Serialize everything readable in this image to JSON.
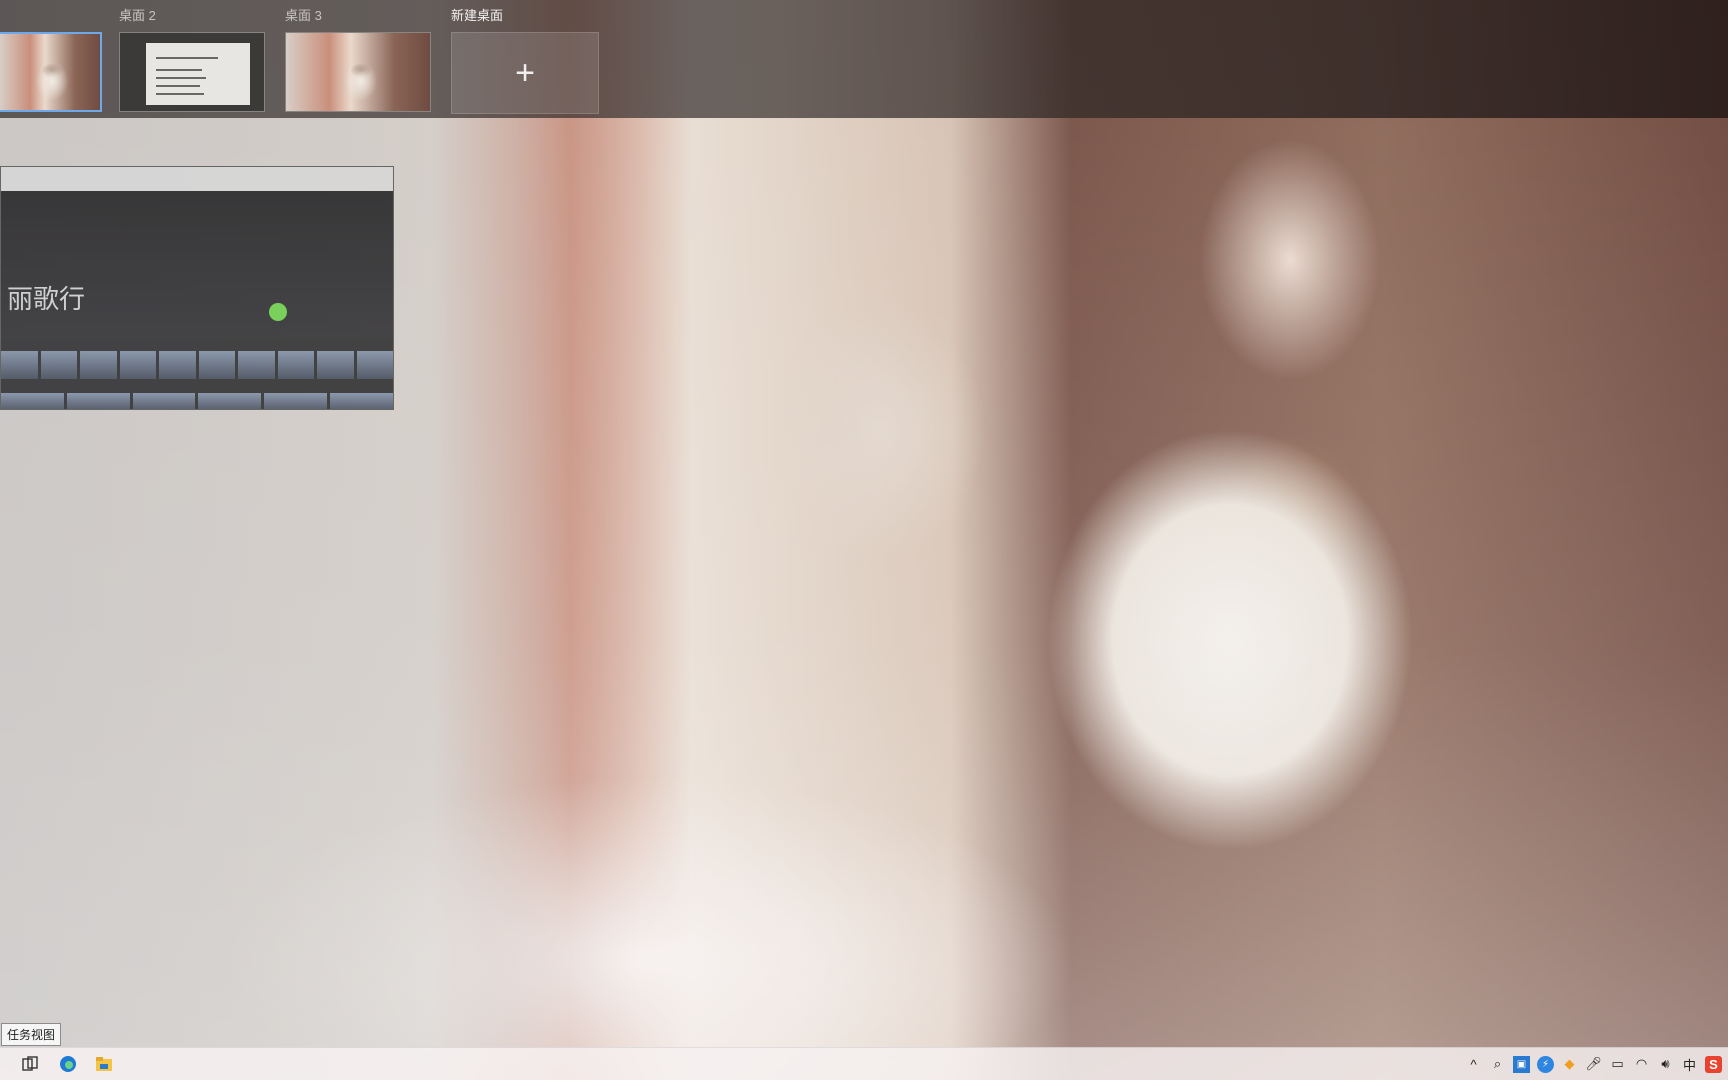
{
  "task_view": {
    "desktops": [
      {
        "label": "",
        "active": true
      },
      {
        "label": "桌面 2",
        "active": false
      },
      {
        "label": "桌面 3",
        "active": false
      }
    ],
    "new_desktop_label": "新建桌面",
    "new_desktop_symbol": "+"
  },
  "window_thumbnail": {
    "hero_title": "丽歌行"
  },
  "taskbar": {
    "tooltip": "任务视图",
    "icons": [
      "task-view-icon",
      "edge-icon",
      "file-explorer-icon"
    ],
    "tray": {
      "chevron": "^",
      "ime": "中",
      "sogou": "S"
    }
  },
  "colors": {
    "active_border": "#6fa8e8",
    "edge_blue": "#1f7ad6",
    "explorer_yellow": "#f4c542",
    "sogou_red": "#e8432f"
  }
}
